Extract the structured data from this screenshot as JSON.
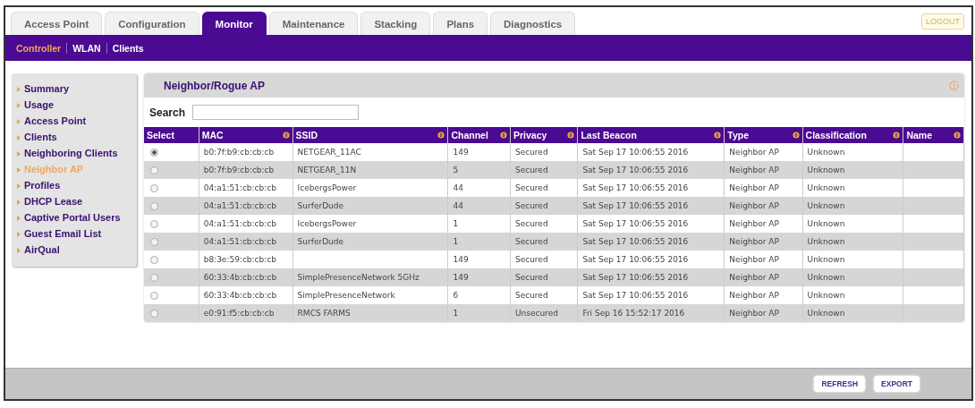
{
  "tabs": [
    {
      "label": "Access Point",
      "selected": false
    },
    {
      "label": "Configuration",
      "selected": false
    },
    {
      "label": "Monitor",
      "selected": true
    },
    {
      "label": "Maintenance",
      "selected": false
    },
    {
      "label": "Stacking",
      "selected": false
    },
    {
      "label": "Plans",
      "selected": false
    },
    {
      "label": "Diagnostics",
      "selected": false
    }
  ],
  "logout": "LOGOUT",
  "subnav": [
    {
      "label": "Controller",
      "selected": true
    },
    {
      "label": "WLAN",
      "selected": false
    },
    {
      "label": "Clients",
      "selected": false
    }
  ],
  "sidebar": {
    "items": [
      {
        "label": "Summary",
        "selected": false
      },
      {
        "label": "Usage",
        "selected": false
      },
      {
        "label": "Access Point",
        "selected": false
      },
      {
        "label": "Clients",
        "selected": false
      },
      {
        "label": "Neighboring Clients",
        "selected": false
      },
      {
        "label": "Neighbor AP",
        "selected": true
      },
      {
        "label": "Profiles",
        "selected": false
      },
      {
        "label": "DHCP Lease",
        "selected": false
      },
      {
        "label": "Captive Portal Users",
        "selected": false
      },
      {
        "label": "Guest Email List",
        "selected": false
      },
      {
        "label": "AirQual",
        "selected": false
      }
    ]
  },
  "panel": {
    "title": "Neighbor/Rogue AP",
    "search": {
      "label": "Search"
    }
  },
  "table": {
    "columns": [
      {
        "label": "Select",
        "sortable": false
      },
      {
        "label": "MAC",
        "sortable": true
      },
      {
        "label": "SSID",
        "sortable": true
      },
      {
        "label": "Channel",
        "sortable": true
      },
      {
        "label": "Privacy",
        "sortable": true
      },
      {
        "label": "Last Beacon",
        "sortable": true
      },
      {
        "label": "Type",
        "sortable": true
      },
      {
        "label": "Classification",
        "sortable": true
      },
      {
        "label": "Name",
        "sortable": true
      }
    ],
    "rows": [
      {
        "selected": true,
        "cells": [
          "",
          "b0:7f:b9:cb:cb:cb",
          "NETGEAR_11AC",
          "149",
          "Secured",
          "Sat Sep 17 10:06:55 2016",
          "Neighbor AP",
          "Unknown",
          ""
        ]
      },
      {
        "selected": false,
        "cells": [
          "",
          "b0:7f:b9:cb:cb:cb",
          "NETGEAR_11N",
          "5",
          "Secured",
          "Sat Sep 17 10:06:55 2016",
          "Neighbor AP",
          "Unknown",
          ""
        ]
      },
      {
        "selected": false,
        "cells": [
          "",
          "04:a1:51:cb:cb:cb",
          "IcebergsPower",
          "44",
          "Secured",
          "Sat Sep 17 10:06:55 2016",
          "Neighbor AP",
          "Unknown",
          ""
        ]
      },
      {
        "selected": false,
        "cells": [
          "",
          "04:a1:51:cb:cb:cb",
          "SurferDude",
          "44",
          "Secured",
          "Sat Sep 17 10:06:55 2016",
          "Neighbor AP",
          "Unknown",
          ""
        ]
      },
      {
        "selected": false,
        "cells": [
          "",
          "04:a1:51:cb:cb:cb",
          "IcebergsPower",
          "1",
          "Secured",
          "Sat Sep 17 10:06:55 2016",
          "Neighbor AP",
          "Unknown",
          ""
        ]
      },
      {
        "selected": false,
        "cells": [
          "",
          "04:a1:51:cb:cb:cb",
          "SurferDude",
          "1",
          "Secured",
          "Sat Sep 17 10:06:55 2016",
          "Neighbor AP",
          "Unknown",
          ""
        ]
      },
      {
        "selected": false,
        "cells": [
          "",
          "b8:3e:59:cb:cb:cb",
          "",
          "149",
          "Secured",
          "Sat Sep 17 10:06:55 2016",
          "Neighbor AP",
          "Unknown",
          ""
        ]
      },
      {
        "selected": false,
        "cells": [
          "",
          "60:33:4b:cb:cb:cb",
          "SimplePresenceNetwork 5GHz",
          "149",
          "Secured",
          "Sat Sep 17 10:06:55 2016",
          "Neighbor AP",
          "Unknown",
          ""
        ]
      },
      {
        "selected": false,
        "cells": [
          "",
          "60:33:4b:cb:cb:cb",
          "SimplePresenceNetwork",
          "6",
          "Secured",
          "Sat Sep 17 10:06:55 2016",
          "Neighbor AP",
          "Unknown",
          ""
        ]
      },
      {
        "selected": false,
        "cells": [
          "",
          "e0:91:f5:cb:cb:cb",
          "RMCS FARMS",
          "1",
          "Unsecured",
          "Fri Sep 16 15:52:17 2016",
          "Neighbor AP",
          "Unknown",
          ""
        ]
      }
    ]
  },
  "buttons": [
    "REFRESH",
    "EXPORT"
  ]
}
